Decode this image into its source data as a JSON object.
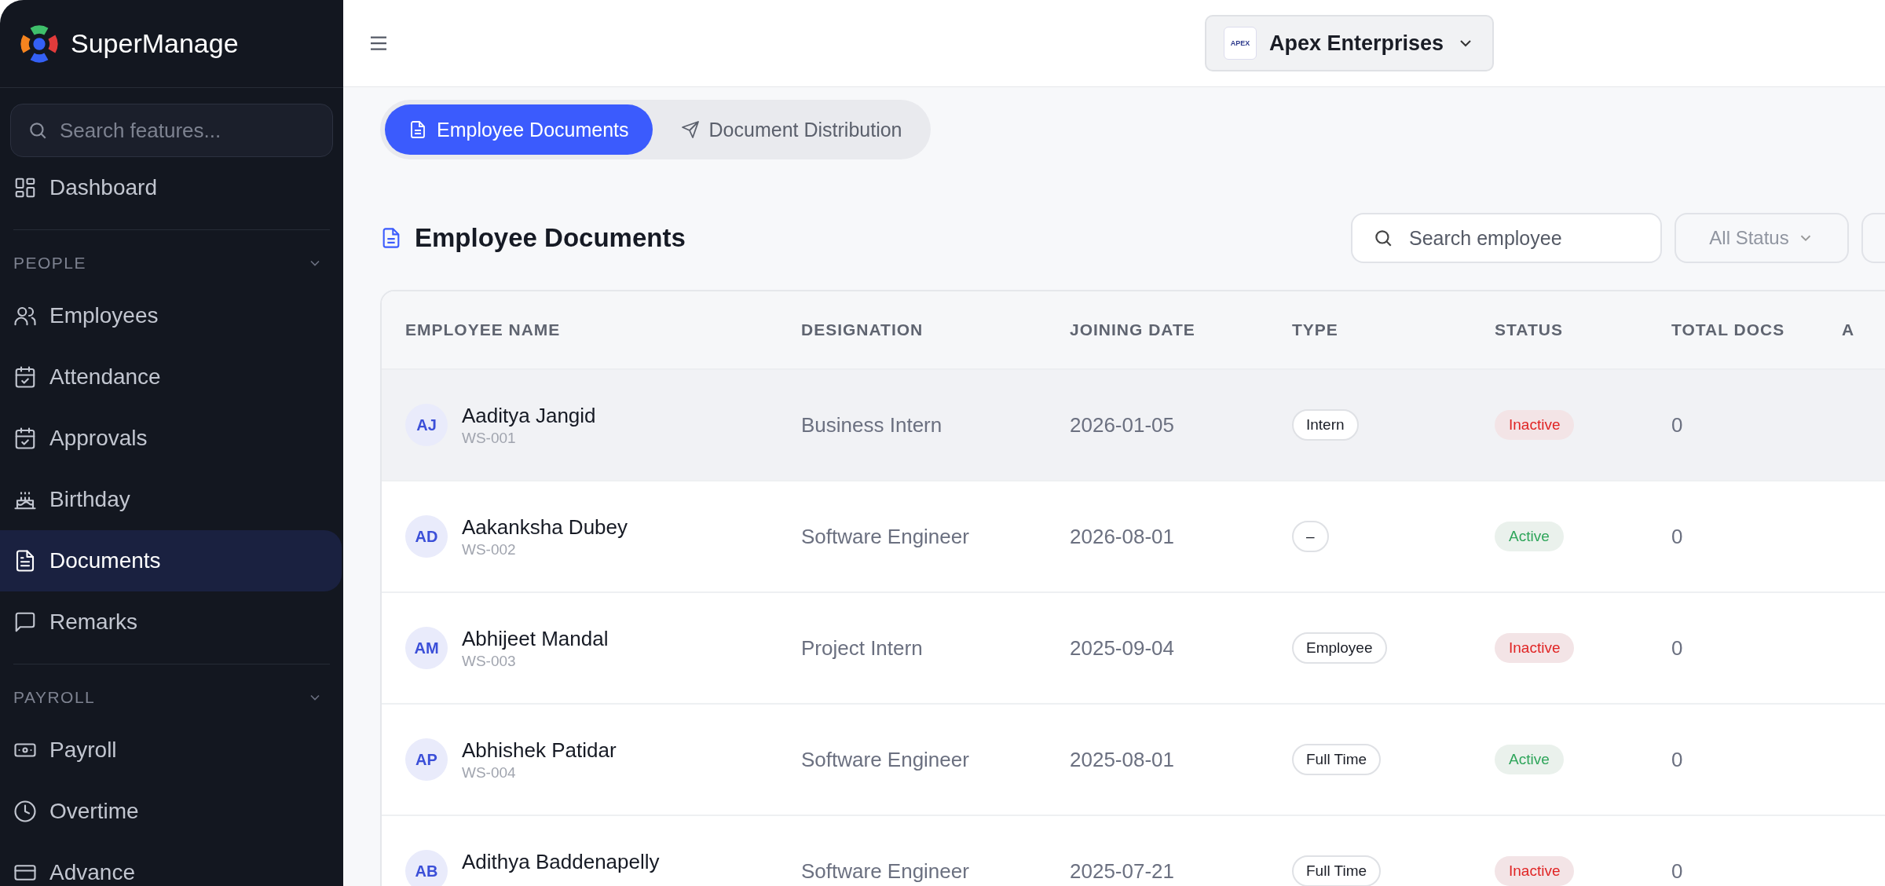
{
  "app": {
    "name": "SuperManage"
  },
  "sidebar": {
    "search": {
      "placeholder": "Search features..."
    },
    "items": [
      {
        "kind": "item",
        "label": "Dashboard",
        "selected": false
      },
      {
        "kind": "divider"
      },
      {
        "kind": "section",
        "label": "PEOPLE",
        "expanded": true
      },
      {
        "kind": "item",
        "label": "Employees",
        "selected": false
      },
      {
        "kind": "item",
        "label": "Attendance",
        "selected": false
      },
      {
        "kind": "item",
        "label": "Approvals",
        "selected": false
      },
      {
        "kind": "item",
        "label": "Birthday",
        "selected": false
      },
      {
        "kind": "item",
        "label": "Documents",
        "selected": true
      },
      {
        "kind": "item",
        "label": "Remarks",
        "selected": false
      },
      {
        "kind": "divider"
      },
      {
        "kind": "section",
        "label": "PAYROLL",
        "expanded": true
      },
      {
        "kind": "item",
        "label": "Payroll",
        "selected": false
      },
      {
        "kind": "item",
        "label": "Overtime",
        "selected": false
      },
      {
        "kind": "item",
        "label": "Advance",
        "selected": false
      }
    ]
  },
  "header": {
    "company": {
      "logo_text": "APEX",
      "name": "Apex Enterprises"
    }
  },
  "tabs": [
    {
      "label": "Employee Documents",
      "selected": true
    },
    {
      "label": "Document Distribution",
      "selected": false
    }
  ],
  "section": {
    "title": "Employee Documents",
    "search": {
      "placeholder": "Search employee"
    },
    "status_filter": "All Status"
  },
  "table": {
    "columns": [
      "EMPLOYEE NAME",
      "DESIGNATION",
      "JOINING DATE",
      "TYPE",
      "STATUS",
      "TOTAL DOCS",
      "A"
    ],
    "rows": [
      {
        "initials": "AJ",
        "name": "Aaditya Jangid",
        "id": "WS-001",
        "designation": "Business Intern",
        "joining_date": "2026-01-05",
        "type": "Intern",
        "status": "Inactive",
        "active": false,
        "total_docs": "0",
        "selected": true
      },
      {
        "initials": "AD",
        "name": "Aakanksha Dubey",
        "id": "WS-002",
        "designation": "Software Engineer",
        "joining_date": "2026-08-01",
        "type": "–",
        "status": "Active",
        "active": true,
        "total_docs": "0",
        "selected": false
      },
      {
        "initials": "AM",
        "name": "Abhijeet Mandal",
        "id": "WS-003",
        "designation": "Project Intern",
        "joining_date": "2025-09-04",
        "type": "Employee",
        "status": "Inactive",
        "active": false,
        "total_docs": "0",
        "selected": false
      },
      {
        "initials": "AP",
        "name": "Abhishek Patidar",
        "id": "WS-004",
        "designation": "Software Engineer",
        "joining_date": "2025-08-01",
        "type": "Full Time",
        "status": "Active",
        "active": true,
        "total_docs": "0",
        "selected": false
      },
      {
        "initials": "AB",
        "name": "Adithya Baddenapelly",
        "designation": "Software Engineer",
        "joining_date": "2025-07-21",
        "type": "Full Time",
        "status": "Inactive",
        "active": false,
        "total_docs": "0",
        "selected": false
      }
    ]
  }
}
